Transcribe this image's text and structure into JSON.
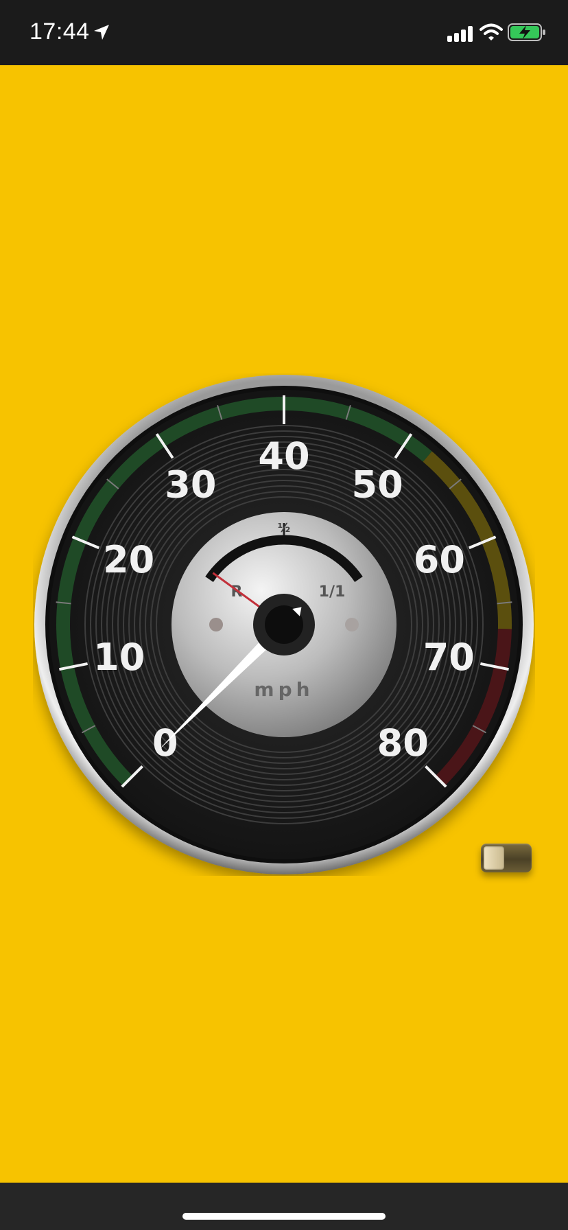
{
  "status_bar": {
    "time": "17:44",
    "icons": [
      "location-arrow-icon",
      "cellular-signal-icon",
      "wifi-icon",
      "battery-charging-icon"
    ]
  },
  "gauge": {
    "unit": "mph",
    "scale_min": 0,
    "scale_max": 80,
    "speed_labels": [
      "0",
      "10",
      "20",
      "30",
      "40",
      "50",
      "60",
      "70",
      "80"
    ],
    "speed_value": 0,
    "fuel_labels": {
      "reserve": "R",
      "half": "½",
      "full": "1/1"
    },
    "fuel_level": 0.05,
    "zone_colors": {
      "green": "#1f4a26",
      "yellow": "#5b4f0e",
      "red": "#4a1518"
    },
    "needle_color": "#ffffff",
    "fuel_needle_color": "#c2303a"
  },
  "toggle": {
    "state": "off"
  },
  "colors": {
    "background": "#f7c300",
    "status_bar": "#1b1b1b",
    "bottom_bar": "#262626"
  }
}
